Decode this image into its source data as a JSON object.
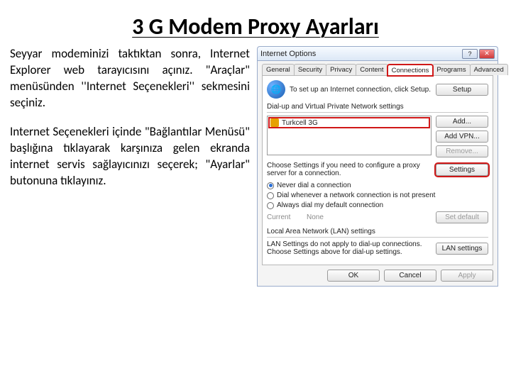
{
  "title": "3 G Modem Proxy Ayarları",
  "paragraphs": {
    "p1": "Seyyar modeminizi taktıktan sonra, Internet Explorer web tarayıcısını açınız. \"Araçlar\" menüsünden ''Internet Seçenekleri'' sekmesini seçiniz.",
    "p2": "Internet Seçenekleri içinde \"Bağlantılar Menüsü\" başlığına tıklayarak karşınıza gelen ekranda internet servis sağlayıcınızı seçerek; \"Ayarlar\" butonuna tıklayınız."
  },
  "dialog": {
    "titlebar": "Internet Options",
    "tabs": {
      "general": "General",
      "security": "Security",
      "privacy": "Privacy",
      "content": "Content",
      "connections": "Connections",
      "programs": "Programs",
      "advanced": "Advanced"
    },
    "setup_text": "To set up an Internet connection, click Setup.",
    "setup_btn": "Setup",
    "group_dialup": "Dial-up and Virtual Private Network settings",
    "connection_item": "Turkcell 3G",
    "btn_add": "Add...",
    "btn_addvpn": "Add VPN...",
    "btn_remove": "Remove...",
    "choose_text": "Choose Settings if you need to configure a proxy server for a connection.",
    "btn_settings": "Settings",
    "radio_never": "Never dial a connection",
    "radio_whenever": "Dial whenever a network connection is not present",
    "radio_always": "Always dial my default connection",
    "current_label": "Current",
    "current_value": "None",
    "btn_setdefault": "Set default",
    "group_lan": "Local Area Network (LAN) settings",
    "lan_text": "LAN Settings do not apply to dial-up connections. Choose Settings above for dial-up settings.",
    "btn_lansettings": "LAN settings",
    "btn_ok": "OK",
    "btn_cancel": "Cancel",
    "btn_apply": "Apply"
  }
}
